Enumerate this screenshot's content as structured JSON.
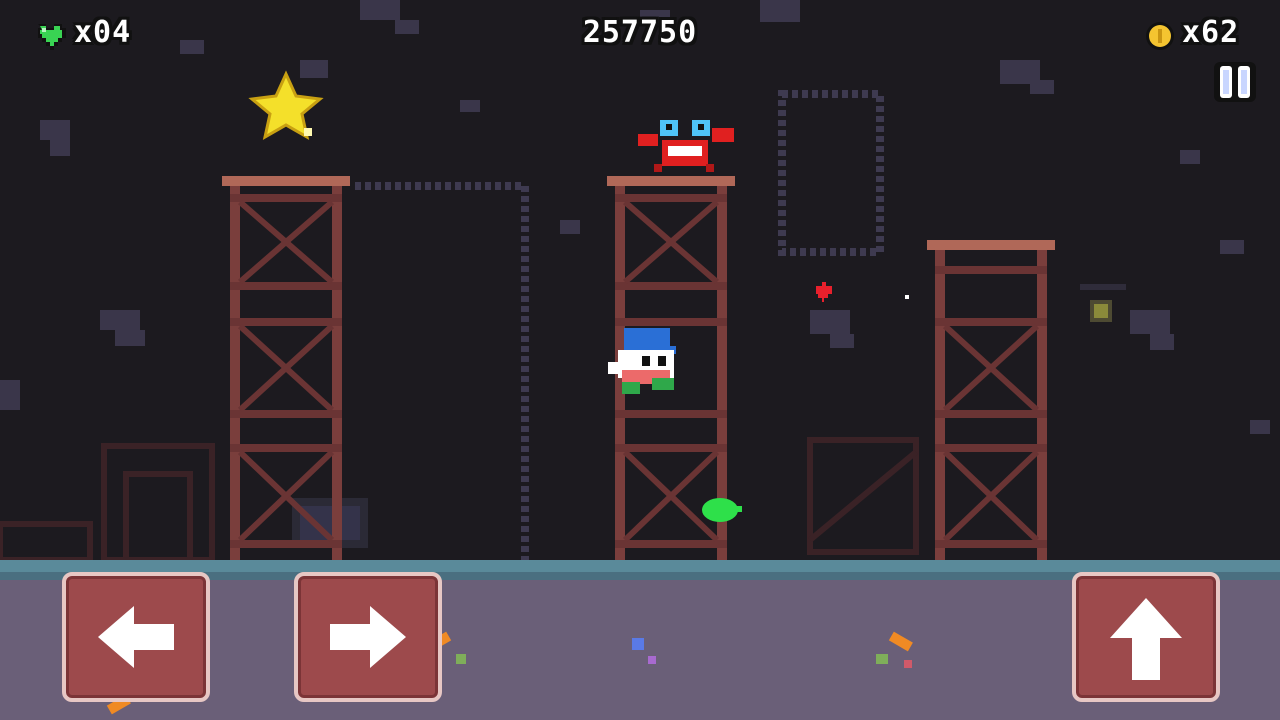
{
  "hud": {
    "lives": "x04",
    "score": "257750",
    "coins": "x62"
  },
  "icons": {
    "lives": "green-heart-icon",
    "coins": "coin-icon",
    "pause": "pause-icon",
    "move_left": "arrow-left-icon",
    "move_right": "arrow-right-icon",
    "jump": "arrow-up-icon"
  },
  "colors": {
    "background": "#1c1a1f",
    "cave_rock": "#3a364a",
    "scaffold": "#7a3e3c",
    "ground": "#6a5f78",
    "ground_top": "#5a8a9a",
    "heart": "#39d353",
    "coin": "#f4c430",
    "button": "#9d4a4c"
  }
}
